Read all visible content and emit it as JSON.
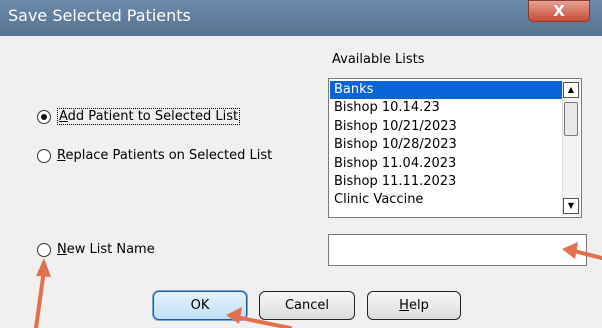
{
  "window": {
    "title": "Save Selected Patients",
    "close_label": "X"
  },
  "options": {
    "add_patient": {
      "accel": "A",
      "rest": "dd Patient to Selected List",
      "checked": true
    },
    "replace_patients": {
      "accel": "R",
      "rest": "eplace Patients on Selected List",
      "checked": false
    },
    "new_list_name": {
      "accel": "N",
      "rest": "ew List Name",
      "checked": false
    }
  },
  "available_lists": {
    "label": "Available Lists",
    "items": [
      "Banks",
      "Bishop 10.14.23",
      "Bishop 10/21/2023",
      "Bishop 10/28/2023",
      "Bishop 11.04.2023",
      "Bishop 11.11.2023",
      "Clinic Vaccine"
    ],
    "selected_index": 0
  },
  "new_list_input": {
    "value": "",
    "placeholder": ""
  },
  "buttons": {
    "ok": "OK",
    "cancel": "Cancel",
    "help_accel": "H",
    "help_rest": "elp"
  },
  "annotation_color": "#e0714d"
}
